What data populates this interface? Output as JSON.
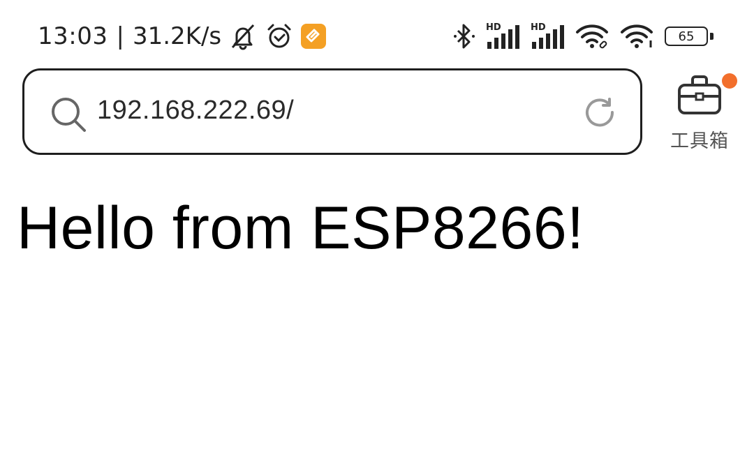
{
  "status_bar": {
    "time": "13:03",
    "separator": "|",
    "net_speed": "31.2K/s",
    "left_icons": [
      "mute-bell-icon",
      "alarm-clock-icon",
      "app-notification-icon"
    ],
    "right_icons": [
      "bluetooth-icon",
      "signal-hd-icon",
      "signal-hd-icon",
      "wifi-link-icon",
      "wifi-icon"
    ],
    "signal_label": "HD",
    "battery_level": "65",
    "app_badge_color": "#f4a024"
  },
  "address_bar": {
    "url": "192.168.222.69/"
  },
  "toolbox": {
    "label": "工具箱",
    "notification_dot_color": "#f26f2c"
  },
  "page": {
    "heading": "Hello from ESP8266!"
  }
}
